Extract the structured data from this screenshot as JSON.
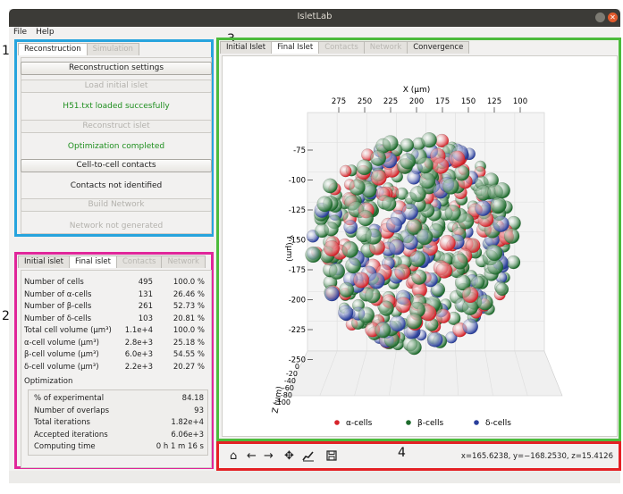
{
  "window": {
    "title": "IsletLab"
  },
  "menu": [
    "File",
    "Help"
  ],
  "labels": [
    "1",
    "2",
    "3",
    "4"
  ],
  "panel1": {
    "tabs": [
      {
        "label": "Reconstruction",
        "active": true,
        "disabled": false
      },
      {
        "label": "Simulation",
        "active": false,
        "disabled": true
      }
    ],
    "reconstruction_settings": "Reconstruction settings",
    "load_initial_islet": "Load initial islet",
    "load_status": "H51.txt loaded succesfully",
    "reconstruct_islet": "Reconstruct islet",
    "optimization_status": "Optimization completed",
    "cell_contacts": "Cell-to-cell contacts",
    "contacts_status": "Contacts not identified",
    "build_network": "Build Network",
    "network_status": "Network not generated"
  },
  "panel2": {
    "tabs": [
      {
        "label": "Initial islet",
        "active": false,
        "disabled": false
      },
      {
        "label": "Final islet",
        "active": true,
        "disabled": false
      },
      {
        "label": "Contacts",
        "active": false,
        "disabled": true
      },
      {
        "label": "Network",
        "active": false,
        "disabled": true
      }
    ],
    "stats": [
      {
        "label": "Number of cells",
        "value": "495",
        "pct": "100.0 %"
      },
      {
        "label": "Number of α-cells",
        "value": "131",
        "pct": "26.46 %"
      },
      {
        "label": "Number of β-cells",
        "value": "261",
        "pct": "52.73 %"
      },
      {
        "label": "Number of δ-cells",
        "value": "103",
        "pct": "20.81 %"
      },
      {
        "label": "Total cell volume (μm³)",
        "value": "1.1e+4",
        "pct": "100.0 %"
      },
      {
        "label": "α-cell volume (μm³)",
        "value": "2.8e+3",
        "pct": "25.18 %"
      },
      {
        "label": "β-cell volume (μm³)",
        "value": "6.0e+3",
        "pct": "54.55 %"
      },
      {
        "label": "δ-cell volume (μm³)",
        "value": "2.2e+3",
        "pct": "20.27 %"
      }
    ],
    "optimization_title": "Optimization",
    "optimization": [
      {
        "label": "% of experimental",
        "value": "84.18"
      },
      {
        "label": "Number of overlaps",
        "value": "93"
      },
      {
        "label": "Total iterations",
        "value": "1.82e+4"
      },
      {
        "label": "Accepted iterations",
        "value": "6.06e+3"
      },
      {
        "label": "Computing time",
        "value": "0 h 1 m 16 s"
      }
    ]
  },
  "panel3": {
    "tabs": [
      {
        "label": "Initial Islet",
        "active": false,
        "disabled": false
      },
      {
        "label": "Final Islet",
        "active": true,
        "disabled": false
      },
      {
        "label": "Contacts",
        "active": false,
        "disabled": true
      },
      {
        "label": "Network",
        "active": false,
        "disabled": true
      },
      {
        "label": "Convergence",
        "active": false,
        "disabled": false
      }
    ]
  },
  "chart_data": {
    "type": "scatter",
    "title": "",
    "xlabel": "X (μm)",
    "ylabel": "Y (μm)",
    "zlabel": "Z (μm)",
    "x_ticks": [
      "275",
      "250",
      "225",
      "200",
      "175",
      "150",
      "125",
      "100"
    ],
    "y_ticks": [
      "-75",
      "-100",
      "-125",
      "-150",
      "-175",
      "-200",
      "-225",
      "-250"
    ],
    "z_ticks": [
      "0",
      "-20",
      "-40",
      "-60",
      "-80",
      "-100"
    ],
    "grid": true,
    "legend_position": "bottom",
    "series": [
      {
        "name": "α-cells",
        "color": "#d6232a",
        "count": 131
      },
      {
        "name": "β-cells",
        "color": "#1d6b2c",
        "count": 261
      },
      {
        "name": "δ-cells",
        "color": "#2a3f9c",
        "count": 103
      }
    ]
  },
  "panel4": {
    "tools": [
      "home-icon",
      "back-icon",
      "forward-icon",
      "pan-icon",
      "subplots-icon",
      "save-icon"
    ],
    "coords": "x=165.6238, y=−168.2530, z=15.4126"
  },
  "colors": {
    "panel1_border": "#27a4dd",
    "panel2_border": "#e0269a",
    "panel3_border": "#4cbb3c",
    "panel4_border": "#e42024",
    "status_green": "#1f8f1f"
  }
}
